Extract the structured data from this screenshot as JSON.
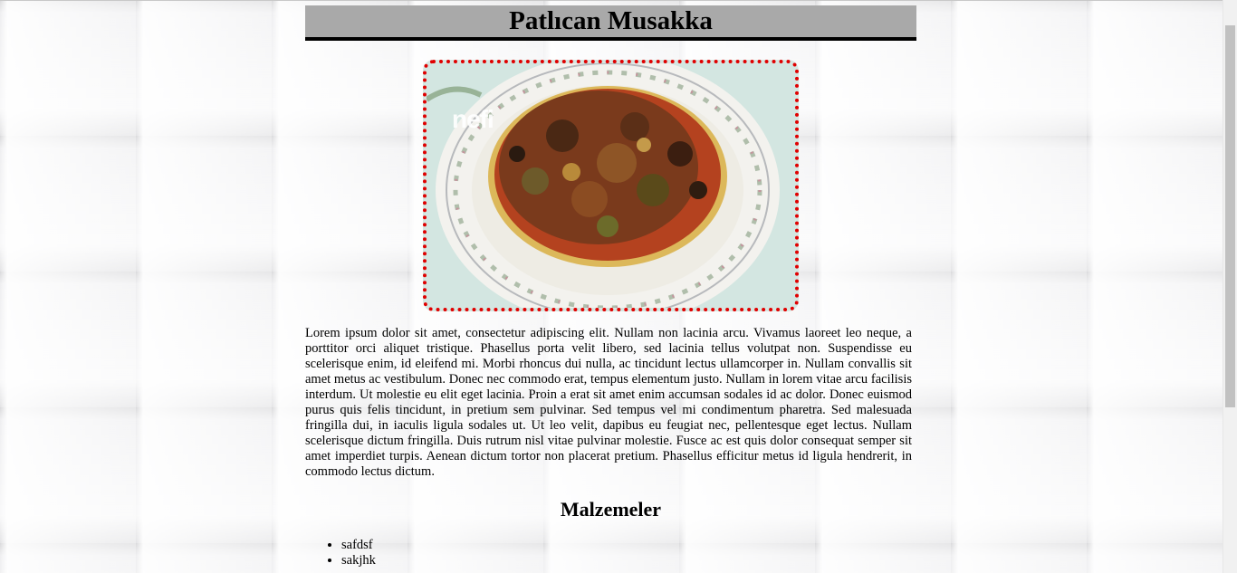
{
  "page": {
    "title": "Patlıcan Musakka",
    "image_watermark": "nefi",
    "description": "Lorem ipsum dolor sit amet, consectetur adipiscing elit. Nullam non lacinia arcu. Vivamus laoreet leo neque, a porttitor orci aliquet tristique. Phasellus porta velit libero, sed lacinia tellus volutpat non. Suspendisse eu scelerisque enim, id eleifend mi. Morbi rhoncus dui nulla, ac tincidunt lectus ullamcorper in. Nullam convallis sit amet metus ac vestibulum. Donec nec commodo erat, tempus elementum justo. Nullam in lorem vitae arcu facilisis interdum. Ut molestie eu elit eget lacinia. Proin a erat sit amet enim accumsan sodales id ac dolor. Donec euismod purus quis felis tincidunt, in pretium sem pulvinar. Sed tempus vel mi condimentum pharetra. Sed malesuada fringilla dui, in iaculis ligula sodales ut. Ut leo velit, dapibus eu feugiat nec, pellentesque eget lectus. Nullam scelerisque dictum fringilla. Duis rutrum nisl vitae pulvinar molestie. Fusce ac est quis dolor consequat semper sit amet imperdiet turpis. Aenean dictum tortor non placerat pretium. Phasellus efficitur metus id ligula hendrerit, in commodo lectus dictum.",
    "ingredients_title": "Malzemeler",
    "ingredients": [
      "safdsf",
      "sakjhk"
    ]
  },
  "colors": {
    "title_bar_bg": "#a9a9a9",
    "image_border": "#e00000",
    "title_underline": "#000000"
  }
}
